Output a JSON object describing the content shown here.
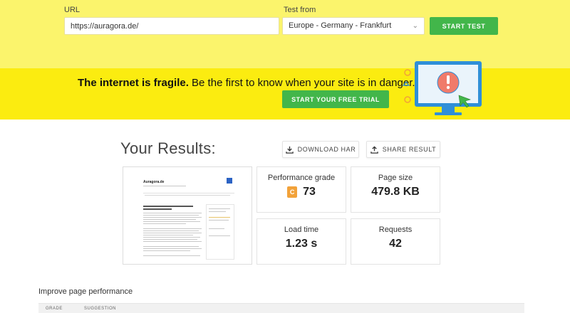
{
  "test_form": {
    "url_label": "URL",
    "url_value": "https://auragora.de/",
    "location_label": "Test from",
    "location_value": "Europe - Germany - Frankfurt",
    "start_button": "START TEST"
  },
  "banner": {
    "headline_bold": "The internet is fragile.",
    "headline_rest": " Be the first to know when your site is in danger.",
    "cta_button": "START YOUR FREE TRIAL"
  },
  "results": {
    "title": "Your Results:",
    "download_button": "DOWNLOAD HAR",
    "share_button": "SHARE RESULT"
  },
  "thumbnail": {
    "site_title": "Auragora.de"
  },
  "metrics": {
    "performance_label": "Performance grade",
    "performance_grade": "C",
    "performance_score": "73",
    "page_size_label": "Page size",
    "page_size_value": "479.8 KB",
    "load_time_label": "Load time",
    "load_time_value": "1.23 s",
    "requests_label": "Requests",
    "requests_value": "42"
  },
  "improve": {
    "title": "Improve page performance",
    "columns": [
      "GRADE",
      "SUGGESTION"
    ]
  },
  "colors": {
    "top_bar": "#fbf46c",
    "banner": "#fbec10",
    "green_button": "#42b64a",
    "grade_c": "#f2a23a",
    "monitor_blue": "#2f8fd8"
  }
}
